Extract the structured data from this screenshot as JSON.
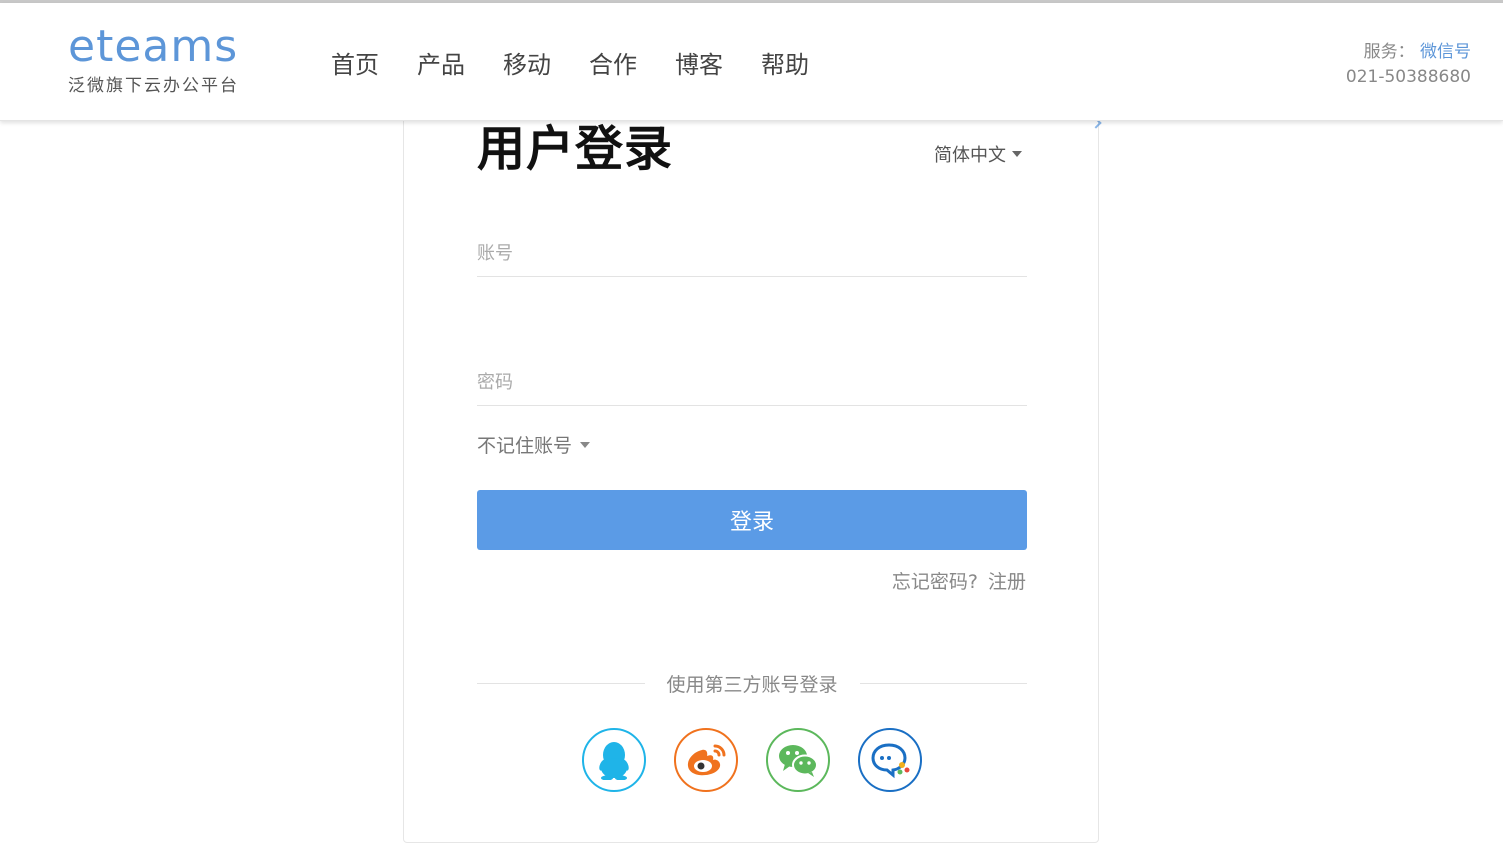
{
  "header": {
    "logo_text": "eteams",
    "logo_subtitle": "泛微旗下云办公平台",
    "nav": [
      {
        "label": "首页"
      },
      {
        "label": "产品"
      },
      {
        "label": "移动"
      },
      {
        "label": "合作"
      },
      {
        "label": "博客"
      },
      {
        "label": "帮助"
      }
    ],
    "service_label": "服务：",
    "wechat_link": "微信号",
    "phone": "021-50388680"
  },
  "login": {
    "title": "用户登录",
    "language": "简体中文",
    "account_placeholder": "账号",
    "password_placeholder": "密码",
    "remember_option": "不记住账号",
    "submit_label": "登录",
    "forgot_label": "忘记密码?",
    "register_label": "注册",
    "third_party_label": "使用第三方账号登录",
    "third_party": [
      {
        "icon": "qq-icon",
        "color": "#1fb4e8"
      },
      {
        "icon": "weibo-icon",
        "color": "#f0721e"
      },
      {
        "icon": "wechat-icon",
        "color": "#5cb85c"
      },
      {
        "icon": "ework-icon",
        "color": "#1a6fc4"
      }
    ]
  },
  "colors": {
    "accent": "#5b9be6",
    "brand": "#5d96d8"
  }
}
